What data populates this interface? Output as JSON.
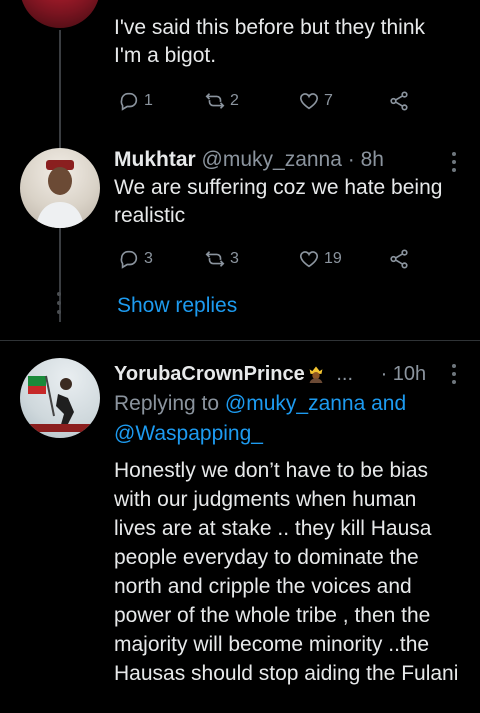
{
  "tweet1": {
    "text": "I've said this before but they think I'm a bigot.",
    "replies": "1",
    "retweets": "2",
    "likes": "7"
  },
  "tweet2": {
    "name": "Mukhtar",
    "handle": "@muky_zanna",
    "time": "· 8h",
    "text": "We are suffering coz we hate being realistic",
    "replies": "3",
    "retweets": "3",
    "likes": "19",
    "show_replies": "Show replies"
  },
  "tweet3": {
    "name": "YorubaCrownPrince",
    "name_ellipsis": "...",
    "time": "· 10h",
    "replying_prefix": "Replying to",
    "replying_to_1": "@muky_zanna and",
    "replying_to_2": "@Waspapping_",
    "text": "Honestly we don’t have to be bias with our judgments when human lives are at stake .. they kill Hausa people everyday to dominate the north and cripple the voices and power of the whole tribe , then the majority will become minority ..the Hausas should stop aiding the Fulani"
  },
  "colors": {
    "link": "#1d9bf0",
    "muted": "#8b949e",
    "background": "#000000"
  },
  "icons": [
    "reply-icon",
    "retweet-icon",
    "like-icon",
    "share-icon",
    "more-icon"
  ]
}
